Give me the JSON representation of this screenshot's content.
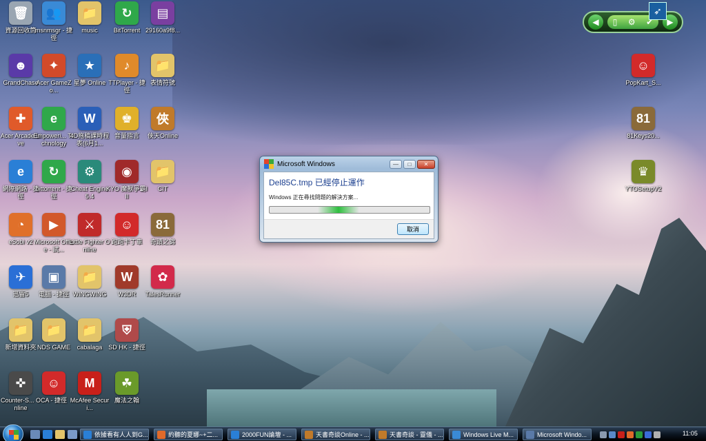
{
  "desktop": {
    "icons": [
      {
        "label": "資源回收筒",
        "color": "#9aa6b2",
        "glyph": "🗑"
      },
      {
        "label": "msnmsgr - 捷徑",
        "color": "#3a8ad6",
        "glyph": "👥"
      },
      {
        "label": "music",
        "color": "#e2c46a",
        "glyph": "📁"
      },
      {
        "label": "BitTorrent",
        "color": "#2fa84a",
        "glyph": "↻"
      },
      {
        "label": "29160a9f8...",
        "color": "#7a3fa0",
        "glyph": "▤"
      },
      {
        "label": "GrandChase",
        "color": "#5a3aa8",
        "glyph": "☻"
      },
      {
        "label": "Acer GameZo...",
        "color": "#d24a2a",
        "glyph": "✦"
      },
      {
        "label": "星夢 Online",
        "color": "#2a6fb8",
        "glyph": "★"
      },
      {
        "label": "TTPlayer - 捷徑",
        "color": "#e08a2a",
        "glyph": "♪"
      },
      {
        "label": "表情符號",
        "color": "#e2c46a",
        "glyph": "📁"
      },
      {
        "label": "Acer Arcade Live",
        "color": "#e05a2a",
        "glyph": "✚"
      },
      {
        "label": "Empoweri... Technology",
        "color": "#2fa84a",
        "glyph": "e"
      },
      {
        "label": "4D拖稿課時程表(6月1...",
        "color": "#2a5fb8",
        "glyph": "W"
      },
      {
        "label": "音量指言",
        "color": "#e0b02a",
        "glyph": "♚"
      },
      {
        "label": "俠天Online",
        "color": "#c07a2a",
        "glyph": "俠"
      },
      {
        "label": "網際網路 - 捷徑",
        "color": "#2a7fd6",
        "glyph": "e"
      },
      {
        "label": "bittorrent - 捷徑",
        "color": "#2fa84a",
        "glyph": "↻"
      },
      {
        "label": "Cheat Engine 5.4",
        "color": "#2a8a7a",
        "glyph": "⚙"
      },
      {
        "label": "KYO 魔獸爭霸III",
        "color": "#a02a2a",
        "glyph": "◉"
      },
      {
        "label": "CIT",
        "color": "#e2c46a",
        "glyph": "📁"
      },
      {
        "label": "eSobi v2",
        "color": "#e0702a",
        "glyph": "◔"
      },
      {
        "label": "Microsoft Office - 試...",
        "color": "#d2582a",
        "glyph": "▶"
      },
      {
        "label": "Little Fighter Online",
        "color": "#c02a2a",
        "glyph": "⚔"
      },
      {
        "label": "跑跑卡丁車",
        "color": "#d22a2a",
        "glyph": "☺"
      },
      {
        "label": "奇蹟之錦",
        "color": "#8a6a3a",
        "glyph": "81"
      },
      {
        "label": "迅雷5",
        "color": "#2a6fd6",
        "glyph": "✈"
      },
      {
        "label": "電腦 - 捷徑",
        "color": "#5a7aa8",
        "glyph": "▣"
      },
      {
        "label": "WINGWING",
        "color": "#e2c46a",
        "glyph": "📁"
      },
      {
        "label": "W3DR",
        "color": "#a03a2a",
        "glyph": "W"
      },
      {
        "label": "TalesRunner",
        "color": "#d22a4a",
        "glyph": "✿"
      },
      {
        "label": "新增資料夾",
        "color": "#e2c46a",
        "glyph": "📁"
      },
      {
        "label": "NDS GAME",
        "color": "#e2c46a",
        "glyph": "📁"
      },
      {
        "label": "cabalaga",
        "color": "#e2c46a",
        "glyph": "📁"
      },
      {
        "label": "SD HK - 捷徑",
        "color": "#b04a4a",
        "glyph": "⛨"
      },
      {
        "label": "Counter-S... Online",
        "color": "#4a4a4a",
        "glyph": "✜"
      },
      {
        "label": "CA - 捷徑",
        "color": "#d22a2a",
        "glyph": "☺"
      },
      {
        "label": "McAfee Securi...",
        "color": "#c8201a",
        "glyph": "M"
      },
      {
        "label": "魔法之翰",
        "color": "#6a9a2a",
        "glyph": "☘"
      },
      {
        "label": "PopKart_S...",
        "color": "#d22a2a",
        "glyph": "☺"
      },
      {
        "label": "81Keys20...",
        "color": "#8a6a3a",
        "glyph": "81"
      },
      {
        "label": "YTOSetupV2",
        "color": "#7a8a2a",
        "glyph": "♛"
      }
    ]
  },
  "dialog": {
    "title": "Microsoft Windows",
    "heading": "Del85C.tmp 已經停止運作",
    "message": "Windows 正在尋找問題的解決方案...",
    "cancel_label": "取消",
    "progress_state": "indeterminate"
  },
  "taskbar": {
    "tasks": [
      "依據看有人人到G...",
      "約聽的夏娜~+二...",
      "2000FUN論壇 - ...",
      "天書奇談Online - ...",
      "天書奇談 - 靈儀 - ...",
      "Windows Live M...",
      "Microsoft Windo..."
    ],
    "clock": "11:05"
  },
  "colors": {
    "taskbar": "#0c1622",
    "dialog_heading": "#1b3f8f",
    "progress": "#2fbf3f"
  }
}
